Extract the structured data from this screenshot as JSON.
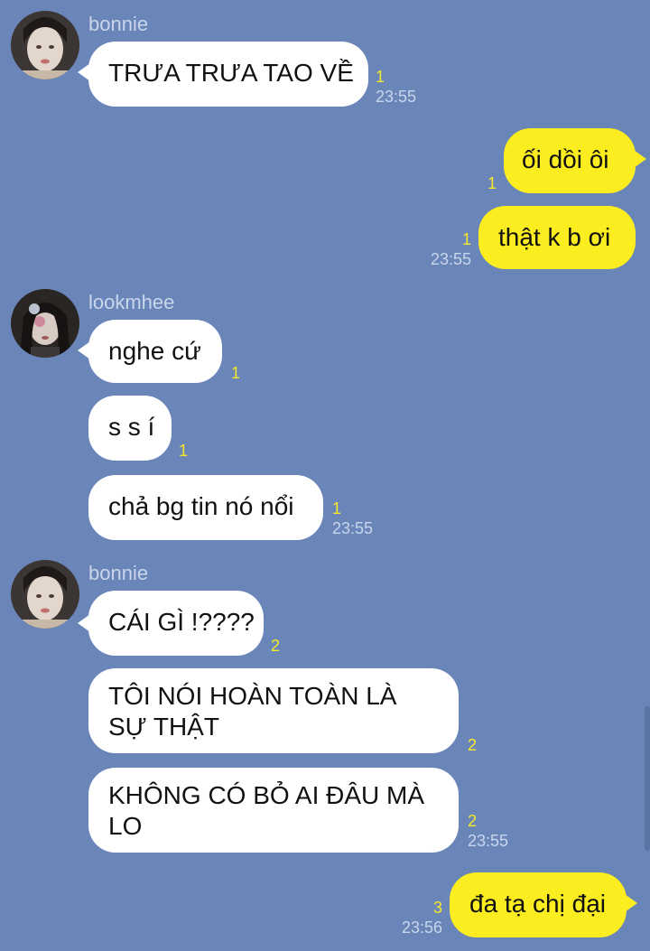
{
  "chat": {
    "groups": [
      {
        "sender": "bonnie",
        "avatar_icon": "avatar-bonnie",
        "messages": [
          {
            "text": "TRƯA TRƯA TAO VỀ",
            "read": "1",
            "time": "23:55"
          }
        ]
      },
      {
        "sender": "me",
        "messages": [
          {
            "text": "ối dồi ôi",
            "read": "1",
            "time": ""
          },
          {
            "text": "thật k b ơi",
            "read": "1",
            "time": "23:55"
          }
        ]
      },
      {
        "sender": "lookmhee",
        "avatar_icon": "avatar-lookmhee",
        "messages": [
          {
            "text": "nghe cứ",
            "read": "1",
            "time": ""
          },
          {
            "text": "s s í",
            "read": "1",
            "time": ""
          },
          {
            "text": "chả bg tin nó nổi",
            "read": "1",
            "time": "23:55"
          }
        ]
      },
      {
        "sender": "bonnie",
        "avatar_icon": "avatar-bonnie",
        "messages": [
          {
            "text": "CÁI GÌ !????",
            "read": "2",
            "time": ""
          },
          {
            "text": "TÔI NÓI HOÀN TOÀN LÀ SỰ THẬT",
            "read": "2",
            "time": ""
          },
          {
            "text": "KHÔNG CÓ BỎ AI ĐÂU MÀ LO",
            "read": "2",
            "time": "23:55"
          }
        ]
      },
      {
        "sender": "me",
        "messages": [
          {
            "text": "đa tạ chị đại",
            "read": "3",
            "time": "23:56"
          }
        ]
      }
    ]
  },
  "colors": {
    "background": "#6a86b8",
    "incoming_bubble": "#ffffff",
    "outgoing_bubble": "#fbed1f",
    "read_count": "#f7e82a",
    "meta_text": "#c9d6ec"
  }
}
